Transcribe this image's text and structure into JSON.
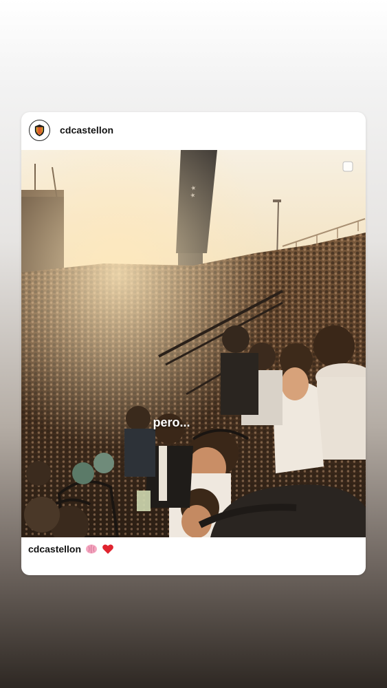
{
  "post": {
    "username": "cdcastellon",
    "overlay_text": "pero...",
    "caption_user": "cdcastellon",
    "caption_emojis": [
      "brain-emoji",
      "red-heart-emoji"
    ]
  },
  "colors": {
    "background_top": "#ffffff",
    "background_bottom": "#2e2823",
    "card": "#ffffff",
    "text": "#111111",
    "overlay_text": "#ffffff"
  },
  "icons": {
    "avatar": "club-crest-icon",
    "multi_select": "square-select-icon"
  }
}
